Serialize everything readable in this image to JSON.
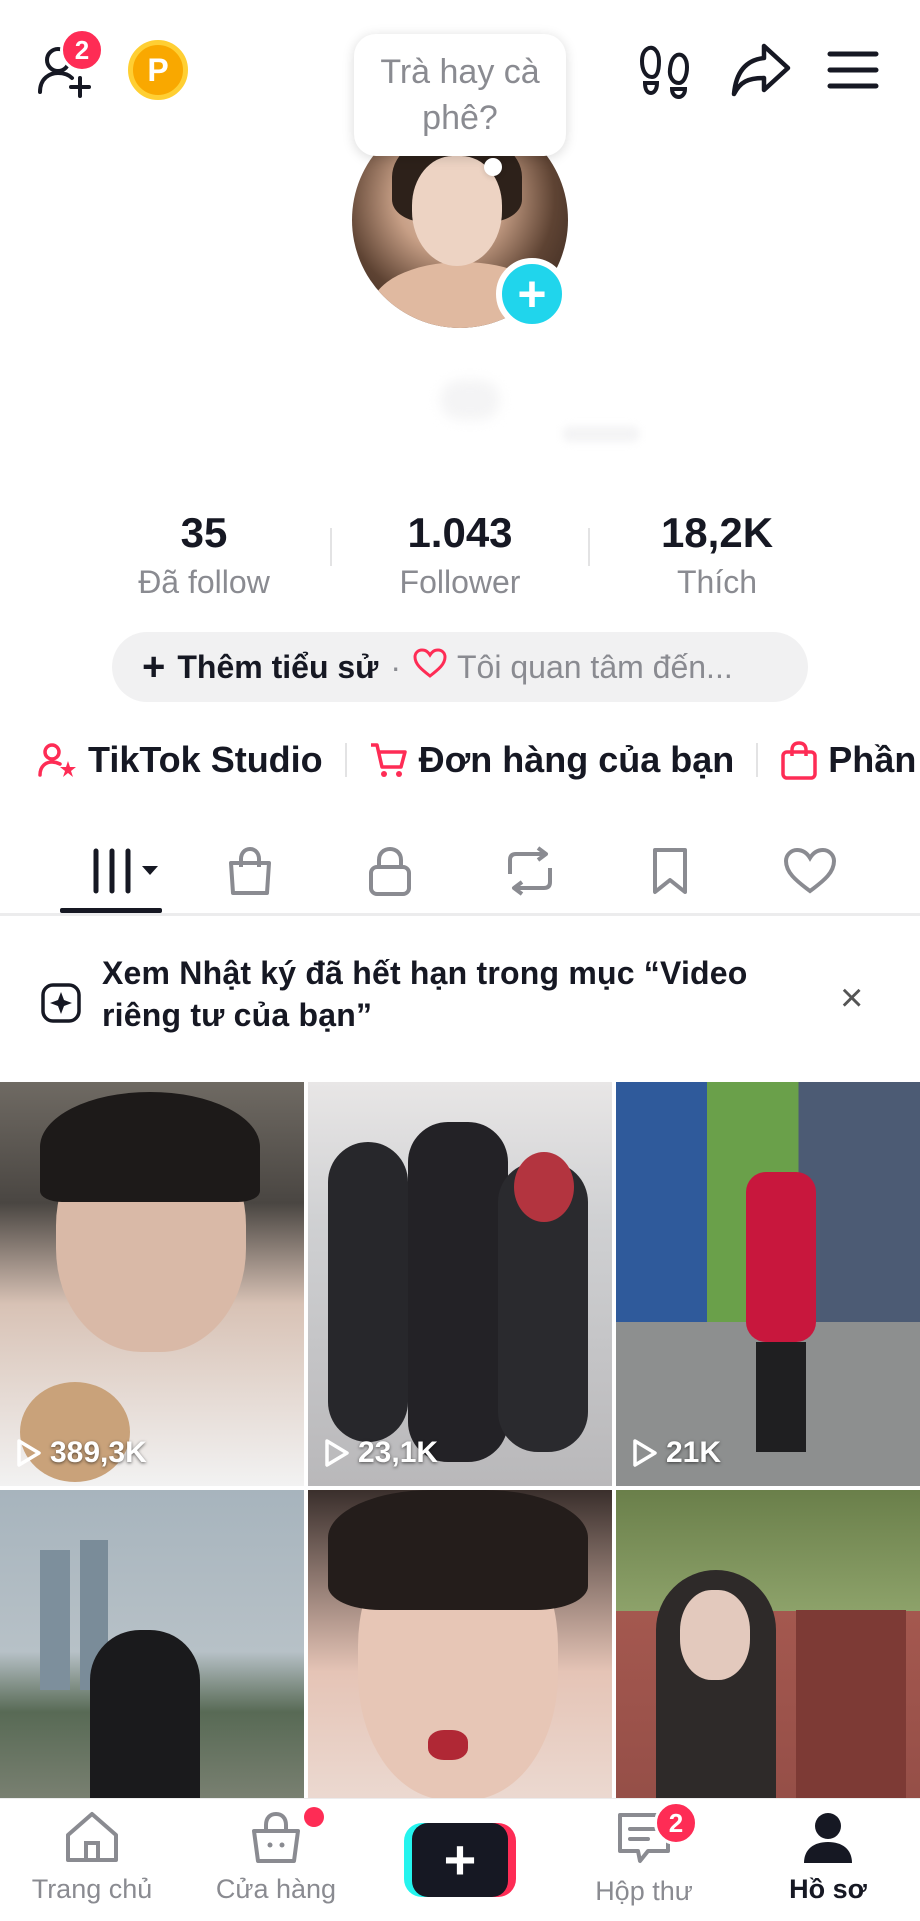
{
  "header": {
    "friend_requests_badge": "2",
    "coin_label": "P",
    "status_bubble": "Trà hay cà phê?"
  },
  "stats": [
    {
      "value": "35",
      "label": "Đã follow"
    },
    {
      "value": "1.043",
      "label": "Follower"
    },
    {
      "value": "18,2K",
      "label": "Thích"
    }
  ],
  "bio": {
    "add_label": "Thêm tiểu sử",
    "separator": "·",
    "interest_label": "Tôi quan tâm đến..."
  },
  "shortcuts": [
    {
      "label": "TikTok Studio",
      "icon": "person-star-icon"
    },
    {
      "label": "Đơn hàng của bạn",
      "icon": "cart-icon"
    },
    {
      "label": "Phần",
      "icon": "bag-icon"
    }
  ],
  "tabs": [
    "videos-grid-icon",
    "shop-bag-icon",
    "lock-icon",
    "repost-icon",
    "bookmark-icon",
    "heart-icon"
  ],
  "notice": {
    "text": "Xem Nhật ký đã hết hạn trong mục “Video riêng tư của bạn”",
    "close": "×"
  },
  "videos": [
    {
      "views": "389,3K",
      "colors": [
        "#6f6a63",
        "#d8c2b5",
        "#f2f2f2"
      ]
    },
    {
      "views": "23,1K",
      "colors": [
        "#cfd0d2",
        "#27272b",
        "#e8e6e6"
      ]
    },
    {
      "views": "21K",
      "colors": [
        "#2f5a9b",
        "#6aa04a",
        "#8d8f8f"
      ]
    },
    {
      "views": "",
      "colors": [
        "#a7b4bd",
        "#586a55",
        "#9d9890"
      ]
    },
    {
      "views": "",
      "colors": [
        "#3a2f2c",
        "#e5c4b6",
        "#f0e8e4"
      ]
    },
    {
      "views": "",
      "colors": [
        "#6a7f4a",
        "#a4584f",
        "#2e2a29"
      ]
    }
  ],
  "bottom_nav": [
    {
      "label": "Trang chủ",
      "icon": "home-icon"
    },
    {
      "label": "Cửa hàng",
      "icon": "shop-icon"
    },
    {
      "label": "",
      "icon": "create-icon"
    },
    {
      "label": "Hộp thư",
      "icon": "inbox-icon",
      "badge": "2"
    },
    {
      "label": "Hồ sơ",
      "icon": "profile-icon"
    }
  ],
  "colors": {
    "accent": "#fe2c55",
    "cyan": "#20d5ec",
    "text": "#161823",
    "muted": "#8a8b91"
  }
}
